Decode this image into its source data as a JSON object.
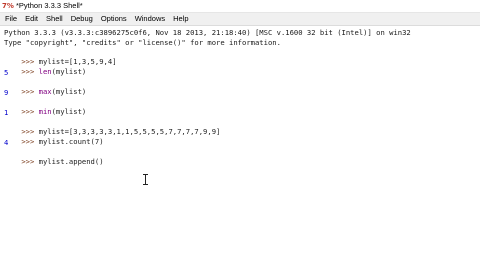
{
  "window": {
    "icon_text": "7%",
    "title": "*Python 3.3.3 Shell*"
  },
  "menubar": {
    "items": [
      "File",
      "Edit",
      "Shell",
      "Debug",
      "Options",
      "Windows",
      "Help"
    ]
  },
  "shell": {
    "banner_line1": "Python 3.3.3 (v3.3.3:c3896275c0f6, Nov 18 2013, 21:18:40) [MSC v.1600 32 bit (Intel)] on win32",
    "banner_line2": "Type \"copyright\", \"credits\" or \"license()\" for more information.",
    "prompt": ">>> ",
    "cmd1": "mylist=[1,3,5,9,4]",
    "cmd2_fn": "len",
    "cmd2_arg": "(mylist)",
    "out2": "5",
    "cmd3_fn": "max",
    "cmd3_arg": "(mylist)",
    "out3": "9",
    "cmd4_fn": "min",
    "cmd4_arg": "(mylist)",
    "out4": "1",
    "cmd5": "mylist=[3,3,3,3,3,1,1,5,5,5,5,7,7,7,7,9,9]",
    "cmd6": "mylist.count(7)",
    "out6": "4",
    "cmd7": "mylist.append()"
  }
}
